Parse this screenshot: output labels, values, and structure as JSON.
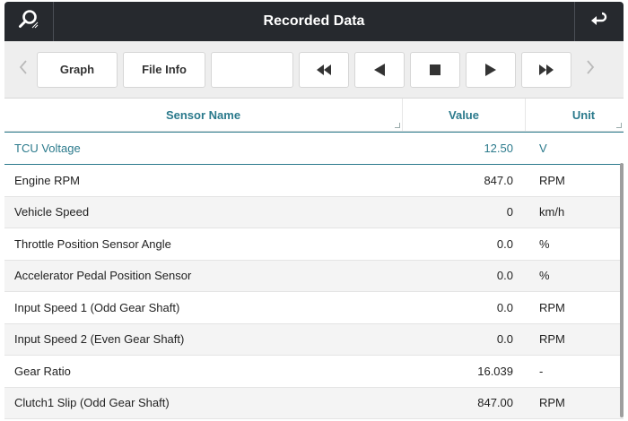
{
  "titlebar": {
    "title": "Recorded Data",
    "left_icon": "search-icon",
    "right_icon": "back-arrow-icon"
  },
  "toolbar": {
    "graph_label": "Graph",
    "file_info_label": "File Info",
    "blank_label": "",
    "icons": [
      "chevron-left-icon",
      "rewind-icon",
      "step-back-icon",
      "stop-icon",
      "play-icon",
      "fast-forward-icon",
      "chevron-right-icon"
    ]
  },
  "table": {
    "headers": {
      "name": "Sensor Name",
      "value": "Value",
      "unit": "Unit"
    },
    "rows": [
      {
        "name": "TCU Voltage",
        "value": "12.50",
        "unit": "V",
        "selected": true
      },
      {
        "name": "Engine RPM",
        "value": "847.0",
        "unit": "RPM"
      },
      {
        "name": "Vehicle Speed",
        "value": "0",
        "unit": "km/h"
      },
      {
        "name": "Throttle Position Sensor Angle",
        "value": "0.0",
        "unit": "%"
      },
      {
        "name": "Accelerator Pedal Position Sensor",
        "value": "0.0",
        "unit": "%"
      },
      {
        "name": "Input Speed 1 (Odd Gear Shaft)",
        "value": "0.0",
        "unit": "RPM"
      },
      {
        "name": "Input Speed 2 (Even Gear Shaft)",
        "value": "0.0",
        "unit": "RPM"
      },
      {
        "name": "Gear Ratio",
        "value": "16.039",
        "unit": "-"
      },
      {
        "name": "Clutch1 Slip (Odd Gear Shaft)",
        "value": "847.00",
        "unit": "RPM"
      }
    ]
  },
  "colors": {
    "titlebar_bg": "#26292e",
    "accent": "#2b7a8c",
    "toolbar_bg": "#eeeeee"
  }
}
